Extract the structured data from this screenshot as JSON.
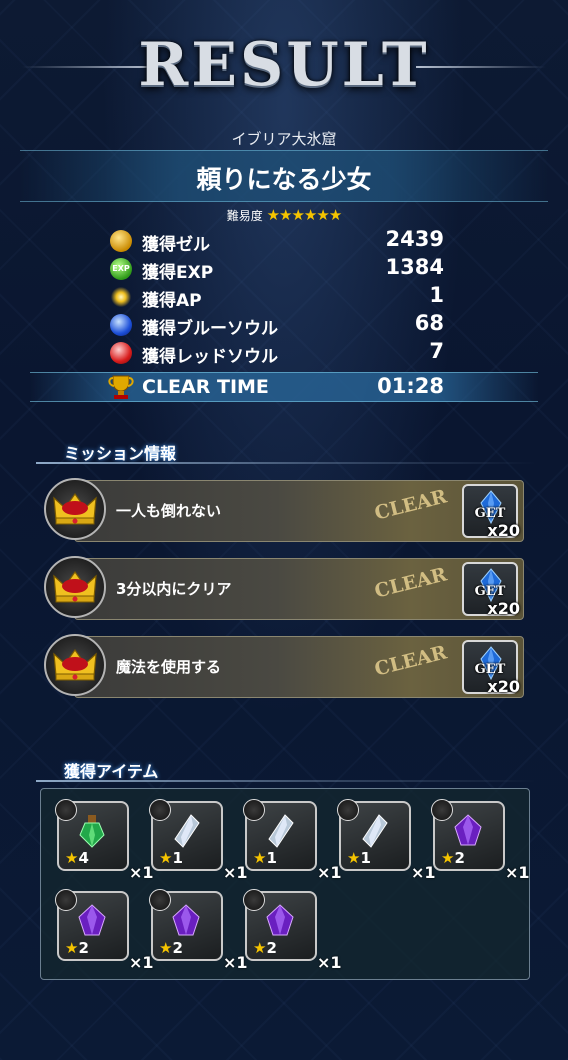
{
  "header": {
    "title": "RESULT",
    "dungeon_name": "イブリア大氷窟",
    "quest_name": "頼りになる少女",
    "difficulty_label": "難易度",
    "difficulty_stars": "★★★★★★"
  },
  "rewards": [
    {
      "icon": "gil-coin-icon",
      "label": "獲得ゼル",
      "value": "2439"
    },
    {
      "icon": "exp-icon",
      "label": "獲得EXP",
      "value": "1384"
    },
    {
      "icon": "ap-sparkle-icon",
      "label": "獲得AP",
      "value": "1"
    },
    {
      "icon": "blue-soul-icon",
      "label": "獲得ブルーソウル",
      "value": "68"
    },
    {
      "icon": "red-soul-icon",
      "label": "獲得レッドソウル",
      "value": "7"
    }
  ],
  "exp_icon_text": "EXP",
  "clear_time": {
    "label": "CLEAR TIME",
    "value": "01:28"
  },
  "missions": {
    "section_title": "ミッション情報",
    "items": [
      {
        "text": "一人も倒れない",
        "status": "CLEAR",
        "reward_label": "GET",
        "reward_count": "x20"
      },
      {
        "text": "3分以内にクリア",
        "status": "CLEAR",
        "reward_label": "GET",
        "reward_count": "x20"
      },
      {
        "text": "魔法を使用する",
        "status": "CLEAR",
        "reward_label": "GET",
        "reward_count": "x20"
      }
    ]
  },
  "items_section": {
    "section_title": "獲得アイテム",
    "items": [
      {
        "icon": "green-potion-icon",
        "rarity": "4",
        "qty": "×1"
      },
      {
        "icon": "silver-crystal-icon",
        "rarity": "1",
        "qty": "×1"
      },
      {
        "icon": "silver-crystal-icon",
        "rarity": "1",
        "qty": "×1"
      },
      {
        "icon": "silver-crystal-icon",
        "rarity": "1",
        "qty": "×1"
      },
      {
        "icon": "purple-crystal-icon",
        "rarity": "2",
        "qty": "×1"
      },
      {
        "icon": "purple-crystal-icon",
        "rarity": "2",
        "qty": "×1"
      },
      {
        "icon": "purple-crystal-icon",
        "rarity": "2",
        "qty": "×1"
      },
      {
        "icon": "purple-crystal-icon",
        "rarity": "2",
        "qty": "×1"
      }
    ]
  },
  "colors": {
    "background": "#0d1a33",
    "star": "#f5c400",
    "band": "#285a88"
  }
}
